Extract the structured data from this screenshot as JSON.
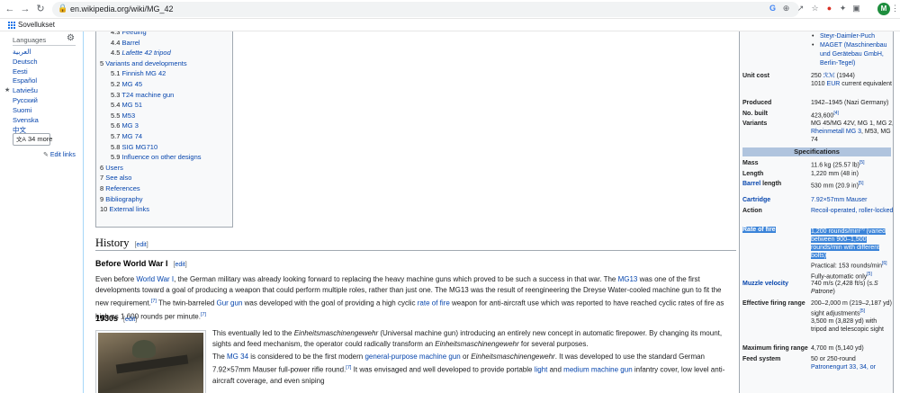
{
  "browser": {
    "url": "en.wikipedia.org/wiki/MG_42",
    "bookmarks_label": "Sovellukset",
    "profile_initial": "M"
  },
  "sidebar": {
    "heading": "Languages",
    "languages": [
      "العربية",
      "Deutsch",
      "Eesti",
      "Español",
      "Latviešu",
      "Русский",
      "Suomi",
      "Svenska",
      "中文"
    ],
    "more_label": "34 more",
    "edit_links": "Edit links"
  },
  "toc": [
    {
      "num": "4.3",
      "label": "Feeding",
      "level": 2
    },
    {
      "num": "4.4",
      "label": "Barrel",
      "level": 2
    },
    {
      "num": "4.5",
      "label": "Lafette 42 tripod",
      "level": 2
    },
    {
      "num": "5",
      "label": "Variants and developments",
      "level": 1
    },
    {
      "num": "5.1",
      "label": "Finnish MG 42",
      "level": 2
    },
    {
      "num": "5.2",
      "label": "MG 45",
      "level": 2
    },
    {
      "num": "5.3",
      "label": "T24 machine gun",
      "level": 2
    },
    {
      "num": "5.4",
      "label": "MG 51",
      "level": 2
    },
    {
      "num": "5.5",
      "label": "M53",
      "level": 2
    },
    {
      "num": "5.6",
      "label": "MG 3",
      "level": 2
    },
    {
      "num": "5.7",
      "label": "MG 74",
      "level": 2
    },
    {
      "num": "5.8",
      "label": "SIG MG710",
      "level": 2
    },
    {
      "num": "5.9",
      "label": "Influence on other designs",
      "level": 2
    },
    {
      "num": "6",
      "label": "Users",
      "level": 1
    },
    {
      "num": "7",
      "label": "See also",
      "level": 1
    },
    {
      "num": "8",
      "label": "References",
      "level": 1
    },
    {
      "num": "9",
      "label": "Bibliography",
      "level": 1
    },
    {
      "num": "10",
      "label": "External links",
      "level": 1
    }
  ],
  "article": {
    "edit_open": "[",
    "edit_label": "edit",
    "edit_close": "]",
    "history_heading": "History",
    "ww1_heading": "Before World War I",
    "ww1_p": {
      "t1": "Even before ",
      "l1": "World War I",
      "t2": ", the German military was already looking forward to replacing the heavy machine guns which proved to be such a success in that war. The ",
      "l2": "MG13",
      "t3": " was one of the first developments toward a goal of producing a weapon that could perform multiple roles, rather than just one. The MG13 was the result of reengineering the Dreyse Water-cooled machine gun to fit the new requirement.",
      "r1": "[7]",
      "t4": " The twin-barreled ",
      "l3": "Gur gun",
      "t5": " was developed with the goal of providing a high cyclic ",
      "l4": "rate of fire",
      "t6": " weapon for anti-aircraft use which was reported to have reached cyclic rates of fire as high as 1,600 rounds per minute.",
      "r2": "[7]"
    },
    "h1930s": "1930s",
    "p1930a": {
      "t1": "This eventually led to the ",
      "i1": "Einheitsmaschinengewehr",
      "t2": " (Universal machine gun) introducing an entirely new concept in automatic firepower. By changing its mount, sights and feed mechanism, the operator could radically transform an ",
      "i2": "Einheitsmaschinengewehr",
      "t3": " for several purposes."
    },
    "p1930b": {
      "t1": "The ",
      "l1": "MG 34",
      "t2": " is considered to be the first modern ",
      "l2": "general-purpose machine gun",
      "t3": " or ",
      "i1": "Einheitsmaschinengewehr",
      "t4": ". It was developed to use the standard German 7.92×57mm Mauser full-power rifle round.",
      "r1": "[7]",
      "t5": " It was envisaged and well developed to provide portable ",
      "l3": "light",
      "t6": " and ",
      "l4": "medium machine gun",
      "t7": " infantry cover, low level anti-aircraft coverage, and even sniping"
    }
  },
  "infobox": {
    "manufacturers": [
      "Steyr-Daimler-Puch",
      "MAGET (Maschinenbau und Gerätebau GmbH, Berlin-Tegel)"
    ],
    "unit_cost_label": "Unit cost",
    "unit_cost_v1a": "250 ",
    "unit_cost_v1b": "ℛℳ",
    "unit_cost_v1c": " (1944)",
    "unit_cost_v2a": "1010 ",
    "unit_cost_v2b": "EUR",
    "unit_cost_v2c": " current equivalent",
    "produced_label": "Produced",
    "produced_value": "1942–1945 (Nazi Germany)",
    "no_built_label": "No. built",
    "no_built_value": "423,600",
    "no_built_ref": "[4]",
    "variants_label": "Variants",
    "variants_v1": "MG 45/MG 42V, MG 1, MG 2, ",
    "variants_link": "Rheinmetall MG 3",
    "variants_v2": ", M53, MG 74",
    "specs_header": "Specifications",
    "mass_label": "Mass",
    "mass_value": "11.6 kg (25.57 lb)",
    "mass_ref": "[5]",
    "length_label": "Length",
    "length_value": "1,220 mm (48 in)",
    "barrel_label": "Barrel",
    "barrel_label_rest": " length",
    "barrel_value": "530 mm (20.9 in)",
    "barrel_ref": "[5]",
    "cartridge_label": "Cartridge",
    "cartridge_value": "7.92×57mm Mauser",
    "action_label": "Action",
    "action_value": "Recoil-operated, roller-locked",
    "rof_label": "Rate of fire",
    "rof_v1": "1,200 rounds/min",
    "rof_ref1": "[5]",
    "rof_v2": " (varied between 900–1,500 rounds/min with different bolts)",
    "rof_v3": "Practical: 153 rounds/min",
    "rof_ref2": "[6]",
    "rof_v4": "Fully-automatic only",
    "rof_ref3": "[5]",
    "muzzle_label": "Muzzle velocity",
    "muzzle_v1": "740 m/s (2,428 ft/s) (",
    "muzzle_v2": "s.S Patrone",
    "muzzle_v3": ")",
    "range_label": "Effective firing range",
    "range_v1": "200–2,000 m (219–2,187 yd) sight adjustments",
    "range_ref": "[5]",
    "range_v2": "3,500 m (3,828 yd) with tripod and telescopic sight",
    "maxrange_label": "Maximum firing range",
    "maxrange_value": "4,700 m (5,140 yd)",
    "feed_label": "Feed system",
    "feed_v1": "50 or 250-round",
    "feed_link": "Patronengurt 33, 34, or"
  }
}
